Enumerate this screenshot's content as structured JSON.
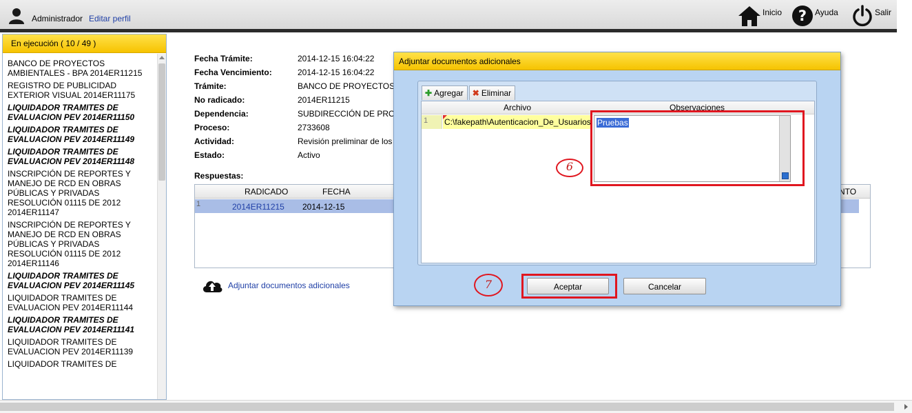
{
  "header": {
    "user_name": "Administrador",
    "edit_profile": "Editar perfil",
    "nav_home": "Inicio",
    "nav_help": "Ayuda",
    "nav_exit": "Salir"
  },
  "sidebar": {
    "header": "En ejecución ( 10 / 49 )",
    "items": [
      {
        "text": "BANCO DE PROYECTOS AMBIENTALES - BPA 2014ER11215",
        "bold": false
      },
      {
        "text": "REGISTRO DE PUBLICIDAD EXTERIOR VISUAL 2014ER11175",
        "bold": false
      },
      {
        "text": "LIQUIDADOR TRAMITES DE EVALUACION PEV 2014ER11150",
        "bold": true
      },
      {
        "text": "LIQUIDADOR TRAMITES DE EVALUACION PEV 2014ER11149",
        "bold": true
      },
      {
        "text": "LIQUIDADOR TRAMITES DE EVALUACION PEV 2014ER11148",
        "bold": true
      },
      {
        "text": "INSCRIPCIÓN DE REPORTES Y MANEJO DE RCD EN OBRAS PÚBLICAS Y PRIVADAS RESOLUCIÓN 01115 DE 2012 2014ER11147",
        "bold": false
      },
      {
        "text": "INSCRIPCIÓN DE REPORTES Y MANEJO DE RCD EN OBRAS PÚBLICAS Y PRIVADAS RESOLUCIÓN 01115 DE 2012 2014ER11146",
        "bold": false
      },
      {
        "text": "LIQUIDADOR TRAMITES DE EVALUACION PEV 2014ER11145",
        "bold": true
      },
      {
        "text": "LIQUIDADOR TRAMITES DE EVALUACION PEV 2014ER11144",
        "bold": false
      },
      {
        "text": "LIQUIDADOR TRAMITES DE EVALUACION PEV 2014ER11141",
        "bold": true
      },
      {
        "text": "LIQUIDADOR TRAMITES DE EVALUACION PEV 2014ER11139",
        "bold": false
      },
      {
        "text": "LIQUIDADOR TRAMITES DE",
        "bold": false
      }
    ]
  },
  "detail": {
    "fecha_tramite_label": "Fecha Trámite:",
    "fecha_tramite": "2014-12-15 16:04:22",
    "fecha_venc_label": "Fecha Vencimiento:",
    "fecha_venc": "2014-12-15 16:04:22",
    "tramite_label": "Trámite:",
    "tramite": "BANCO DE PROYECTOS",
    "radicado_label": "No radicado:",
    "radicado": "2014ER11215",
    "dependencia_label": "Dependencia:",
    "dependencia": "SUBDIRECCIÓN DE PROC",
    "proceso_label": "Proceso:",
    "proceso": "2733608",
    "actividad_label": "Actividad:",
    "actividad": "Revisión preliminar de los",
    "estado_label": "Estado:",
    "estado": "Activo",
    "respuestas_label": "Respuestas:"
  },
  "responses": {
    "col_radicado": "RADICADO",
    "col_fecha": "FECHA",
    "col_right": "NTO",
    "row_num": "1",
    "row_radicado": "2014ER11215",
    "row_fecha": "2014-12-15"
  },
  "attach_link": "Adjuntar documentos adicionales",
  "modal": {
    "title": "Adjuntar documentos adicionales",
    "add_button": "Agregar",
    "delete_button": "Eliminar",
    "col_archivo": "Archivo",
    "col_observaciones": "Observaciones",
    "row_num": "1",
    "file_value": "C:\\fakepath\\Autenticacion_De_Usuarios",
    "observation_value": "Pruebas",
    "accept_button": "Aceptar",
    "cancel_button": "Cancelar"
  },
  "annotations": {
    "step6": "6",
    "step7": "7"
  },
  "colors": {
    "accent_yellow": "#f5c300",
    "annotation_red": "#e0161f",
    "link_blue": "#1f3fa6",
    "selected_row": "#a9bde6"
  }
}
